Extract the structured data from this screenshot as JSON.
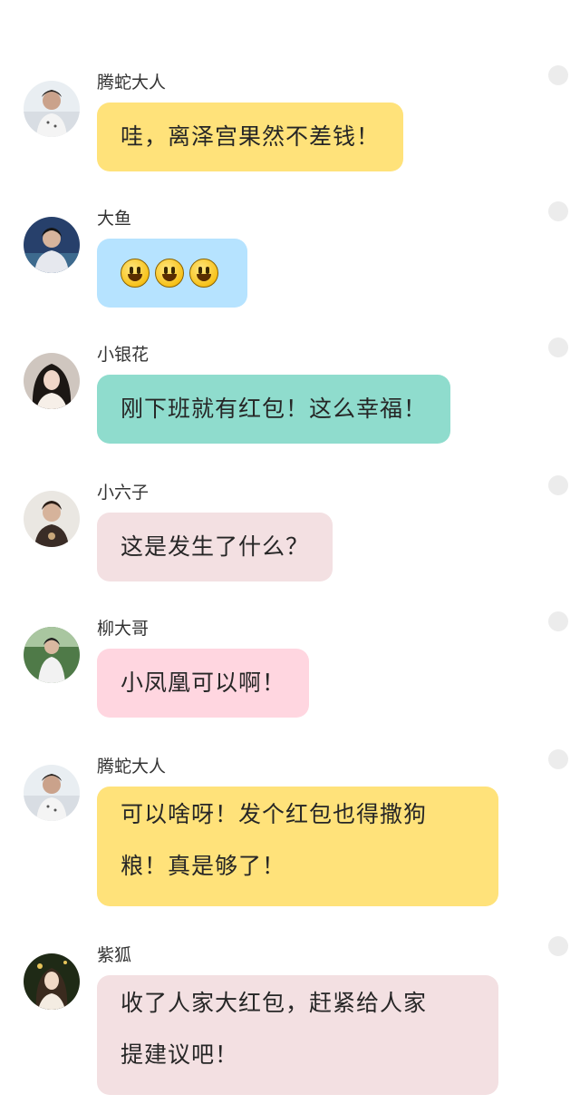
{
  "messages": [
    {
      "name": "腾蛇大人",
      "text": "哇，离泽宫果然不差钱！",
      "color": "#ffe27a",
      "avatar": "avatar-tengshe"
    },
    {
      "name": "大鱼",
      "text": "",
      "emoji": [
        "smiley-emoji",
        "smiley-emoji",
        "smiley-emoji"
      ],
      "color": "#b6e3ff",
      "avatar": "avatar-dayu"
    },
    {
      "name": "小银花",
      "text": "刚下班就有红包！这么幸福！",
      "color": "#8fdccd",
      "avatar": "avatar-xiaoyinhua"
    },
    {
      "name": "小六子",
      "text": "这是发生了什么？",
      "color": "#f3e0e2",
      "avatar": "avatar-xiaoliuzi"
    },
    {
      "name": "柳大哥",
      "text": "小凤凰可以啊！",
      "color": "#ffd6e0",
      "avatar": "avatar-liudage"
    },
    {
      "name": "腾蛇大人",
      "text_lines": [
        "可以啥呀！发个红包也得撒狗",
        "粮！真是够了！"
      ],
      "color": "#ffe27a",
      "avatar": "avatar-tengshe"
    },
    {
      "name": "紫狐",
      "text_lines": [
        "收了人家大红包，赶紧给人家",
        "提建议吧！"
      ],
      "color": "#f3e0e2",
      "avatar": "avatar-zihu"
    }
  ]
}
